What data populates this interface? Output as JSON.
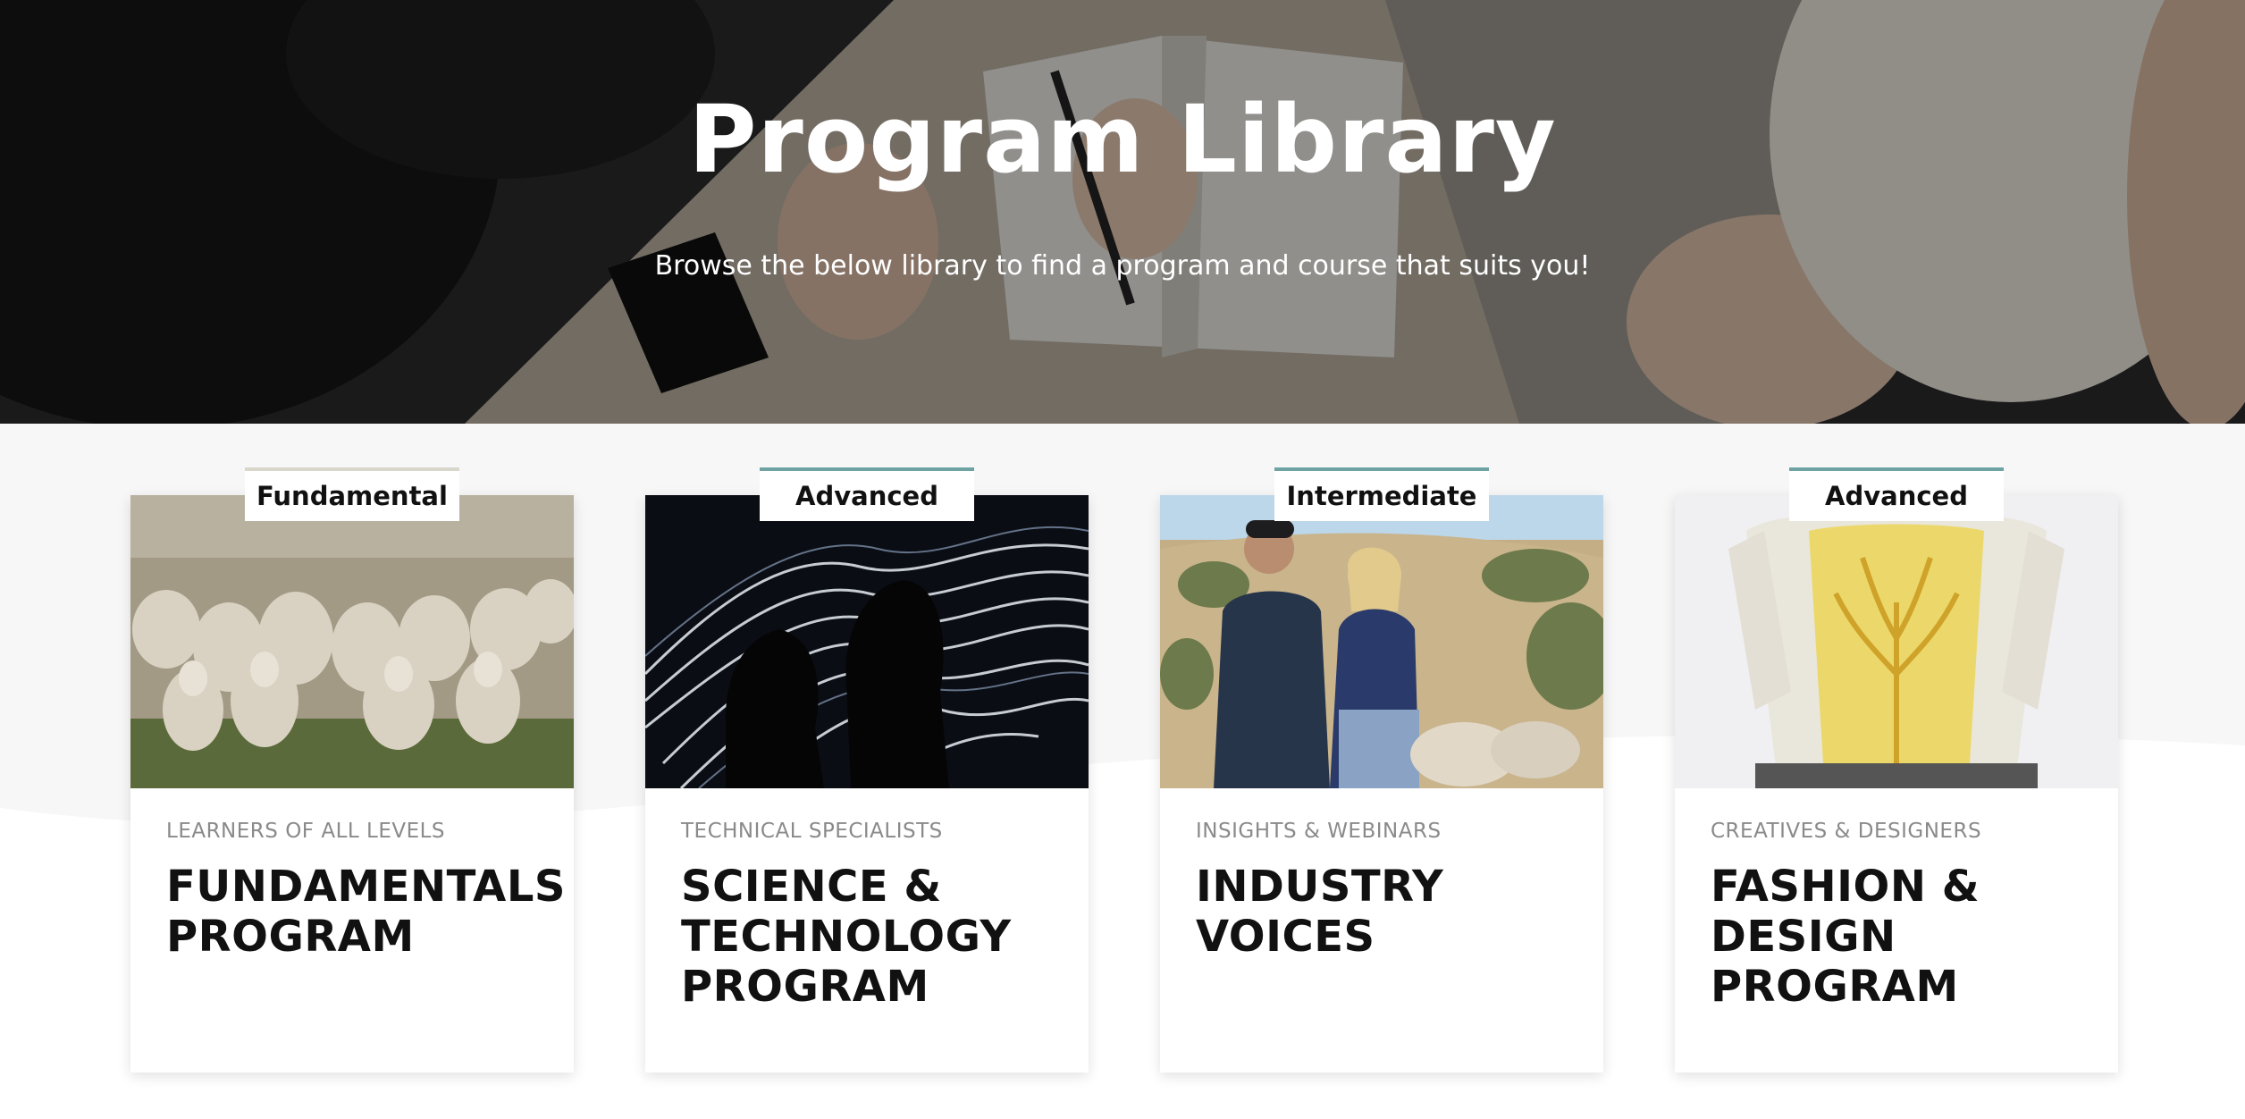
{
  "hero": {
    "title": "Program Library",
    "subtitle": "Browse the below library to find a program and course that suits you!"
  },
  "cards": [
    {
      "badge": "Fundamental",
      "category": "LEARNERS OF ALL LEVELS",
      "title": "FUNDAMENTALS PROGRAM",
      "image": "flock-of-sheep"
    },
    {
      "badge": "Advanced",
      "category": "TECHNICAL SPECIALISTS",
      "title": "SCIENCE & TECHNOLOGY PROGRAM",
      "image": "silhouettes-light-fibers"
    },
    {
      "badge": "Intermediate",
      "category": "INSIGHTS & WEBINARS",
      "title": "INDUSTRY VOICES",
      "image": "couple-with-sheep"
    },
    {
      "badge": "Advanced",
      "category": "CREATIVES & DESIGNERS",
      "title": "FASHION & DESIGN PROGRAM",
      "image": "knitted-garment-tree"
    }
  ],
  "colors": {
    "badge_accent": "#6fa3a3",
    "background": "#f7f7f7"
  }
}
